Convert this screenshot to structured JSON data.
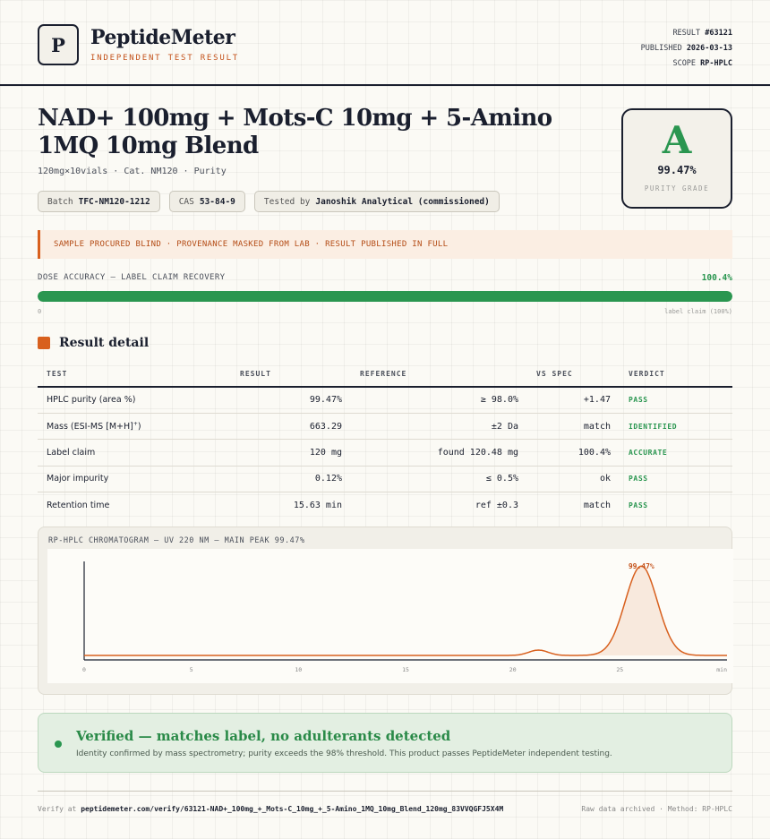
{
  "header": {
    "logo_letter": "P",
    "brand": "PeptideMeter",
    "brand_sub": "INDEPENDENT TEST RESULT",
    "meta": [
      {
        "label": "RESULT",
        "value": "#63121"
      },
      {
        "label": "PUBLISHED",
        "value": "2026-03-13"
      },
      {
        "label": "SCOPE",
        "value": "RP-HPLC"
      }
    ]
  },
  "product": {
    "title": "NAD+ 100mg + Mots-C 10mg + 5-Amino 1MQ 10mg Blend",
    "subtitle": "120mg×10vials · Cat. NM120 · Purity",
    "chips": [
      {
        "label": "Batch",
        "value": "TFC-NM120-1212"
      },
      {
        "label": "CAS",
        "value": "53-84-9"
      },
      {
        "label": "Tested by",
        "value": "Janoshik Analytical (commissioned)"
      }
    ]
  },
  "grade": {
    "letter": "A",
    "value": "99.47%",
    "label": "PURITY GRADE"
  },
  "notice": "SAMPLE PROCURED BLIND · PROVENANCE MASKED FROM LAB · RESULT PUBLISHED IN FULL",
  "dose": {
    "label": "DOSE ACCURACY — LABEL CLAIM RECOVERY",
    "value": "100.4%",
    "fill_fraction": 1.0,
    "min_label": "0",
    "max_label": "label claim (100%)"
  },
  "section_title": "Result detail",
  "table": {
    "headers": {
      "test": "TEST",
      "result": "RESULT",
      "reference": "REFERENCE",
      "spec": "VS SPEC",
      "verdict": "VERDICT"
    },
    "rows": [
      {
        "test": "HPLC purity (area %)",
        "result": "99.47%",
        "reference": "≥ 98.0%",
        "spec": "+1.47",
        "verdict": "PASS"
      },
      {
        "test": "Mass (ESI-MS [M+H]",
        "test_sup": "+",
        "test_end": ")",
        "result": "663.29",
        "reference": "±2 Da",
        "spec": "match",
        "verdict": "IDENTIFIED"
      },
      {
        "test": "Label claim",
        "result": "120 mg",
        "reference": "found 120.48 mg",
        "spec": "100.4%",
        "verdict": "ACCURATE"
      },
      {
        "test": "Major impurity",
        "result": "0.12%",
        "reference": "≤ 0.5%",
        "spec": "ok",
        "verdict": "PASS"
      },
      {
        "test": "Retention time",
        "result": "15.63 min",
        "reference": "ref ±0.3",
        "spec": "match",
        "verdict": "PASS"
      }
    ]
  },
  "chromatogram": {
    "title": "RP-HPLC CHROMATOGRAM — UV 220 NM — MAIN PEAK 99.47%",
    "peak_label": "99.47%",
    "x_ticks": [
      "0",
      "5",
      "10",
      "15",
      "20",
      "25",
      "min"
    ],
    "line_color": "#d8601e"
  },
  "chart_data": {
    "type": "line",
    "title": "RP-HPLC CHROMATOGRAM — UV 220 NM — MAIN PEAK 99.47%",
    "x_ticks": [
      0,
      5,
      10,
      15,
      20,
      25
    ],
    "x_unit": "min",
    "xlim": [
      0,
      30
    ],
    "peaks": [
      {
        "rt": 21.2,
        "rel_height": 0.06
      },
      {
        "rt": 26.0,
        "rel_height": 1.0,
        "label": "99.47%"
      }
    ]
  },
  "verified": {
    "title": "Verified — matches label, no adulterants detected",
    "desc": "Identity confirmed by mass spectrometry; purity exceeds the 98% threshold. This product passes PeptideMeter independent testing."
  },
  "footer": {
    "verify_prefix": "Verify at",
    "verify_url": "peptidemeter.com/verify/63121-NAD+_100mg_+_Mots-C_10mg_+_5-Amino_1MQ_10mg_Blend_120mg_83VVQGFJ5X4M",
    "right": "Raw data archived · Method: RP-HPLC"
  },
  "colors": {
    "accent": "#d8601e",
    "pass": "#2a9650",
    "ink": "#1a1f2e"
  }
}
